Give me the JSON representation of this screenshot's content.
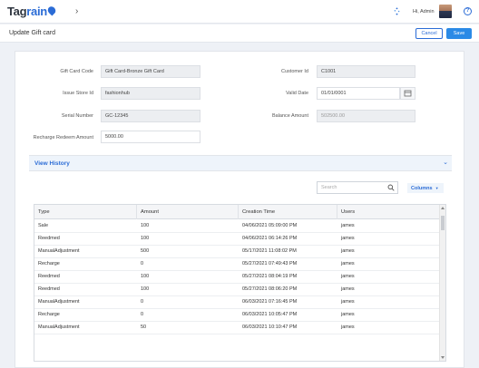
{
  "header": {
    "logo_main": "Tag",
    "logo_accent": "rain",
    "greeting": "Hi, Admin",
    "help_glyph": "?",
    "chevron_icon": "chevron-right-icon",
    "loader_icon": "spinner-icon"
  },
  "page": {
    "title": "Update Gift card",
    "cancel_label": "Cancel",
    "save_label": "Save"
  },
  "form": {
    "gift_card_code": {
      "label": "Gift Card Code",
      "value": "Gift Card-Bronze Gift Card"
    },
    "issue_store_id": {
      "label": "Issue Store Id",
      "value": "fashionhub"
    },
    "serial_number": {
      "label": "Serial Number",
      "value": "GC-12345"
    },
    "recharge_redeem_amount": {
      "label": "Recharge Redeem Amount",
      "value": "5000.00"
    },
    "customer_id": {
      "label": "Customer Id",
      "value": "C1001"
    },
    "valid_date": {
      "label": "Valid Date",
      "value": "01/01/0001"
    },
    "balance_amount": {
      "label": "Balance Amount",
      "value": "502500.00"
    }
  },
  "history": {
    "title": "View History",
    "search_placeholder": "Search",
    "columns_label": "Columns",
    "headers": [
      "Type",
      "Amount",
      "Creation Time",
      "Users"
    ],
    "rows": [
      {
        "type": "Sale",
        "amount": "100",
        "time": "04/06/2021 05:09:00 PM",
        "user": "james"
      },
      {
        "type": "Reedmed",
        "amount": "100",
        "time": "04/06/2021 06:14:26 PM",
        "user": "james"
      },
      {
        "type": "ManualAdjustment",
        "amount": "500",
        "time": "05/17/2021 11:08:02 PM",
        "user": "james"
      },
      {
        "type": "Recharge",
        "amount": "0",
        "time": "05/27/2021 07:49:43 PM",
        "user": "james"
      },
      {
        "type": "Reedmed",
        "amount": "100",
        "time": "05/27/2021 08:04:19 PM",
        "user": "james"
      },
      {
        "type": "Reedmed",
        "amount": "100",
        "time": "05/27/2021 08:06:20 PM",
        "user": "james"
      },
      {
        "type": "ManualAdjustment",
        "amount": "0",
        "time": "06/03/2021 07:16:45 PM",
        "user": "james"
      },
      {
        "type": "Recharge",
        "amount": "0",
        "time": "06/03/2021 10:05:47 PM",
        "user": "james"
      },
      {
        "type": "ManualAdjustment",
        "amount": "50",
        "time": "06/03/2021 10:10:47 PM",
        "user": "james"
      }
    ]
  },
  "colors": {
    "accent": "#2b6cd6",
    "save": "#2b8ae6"
  }
}
